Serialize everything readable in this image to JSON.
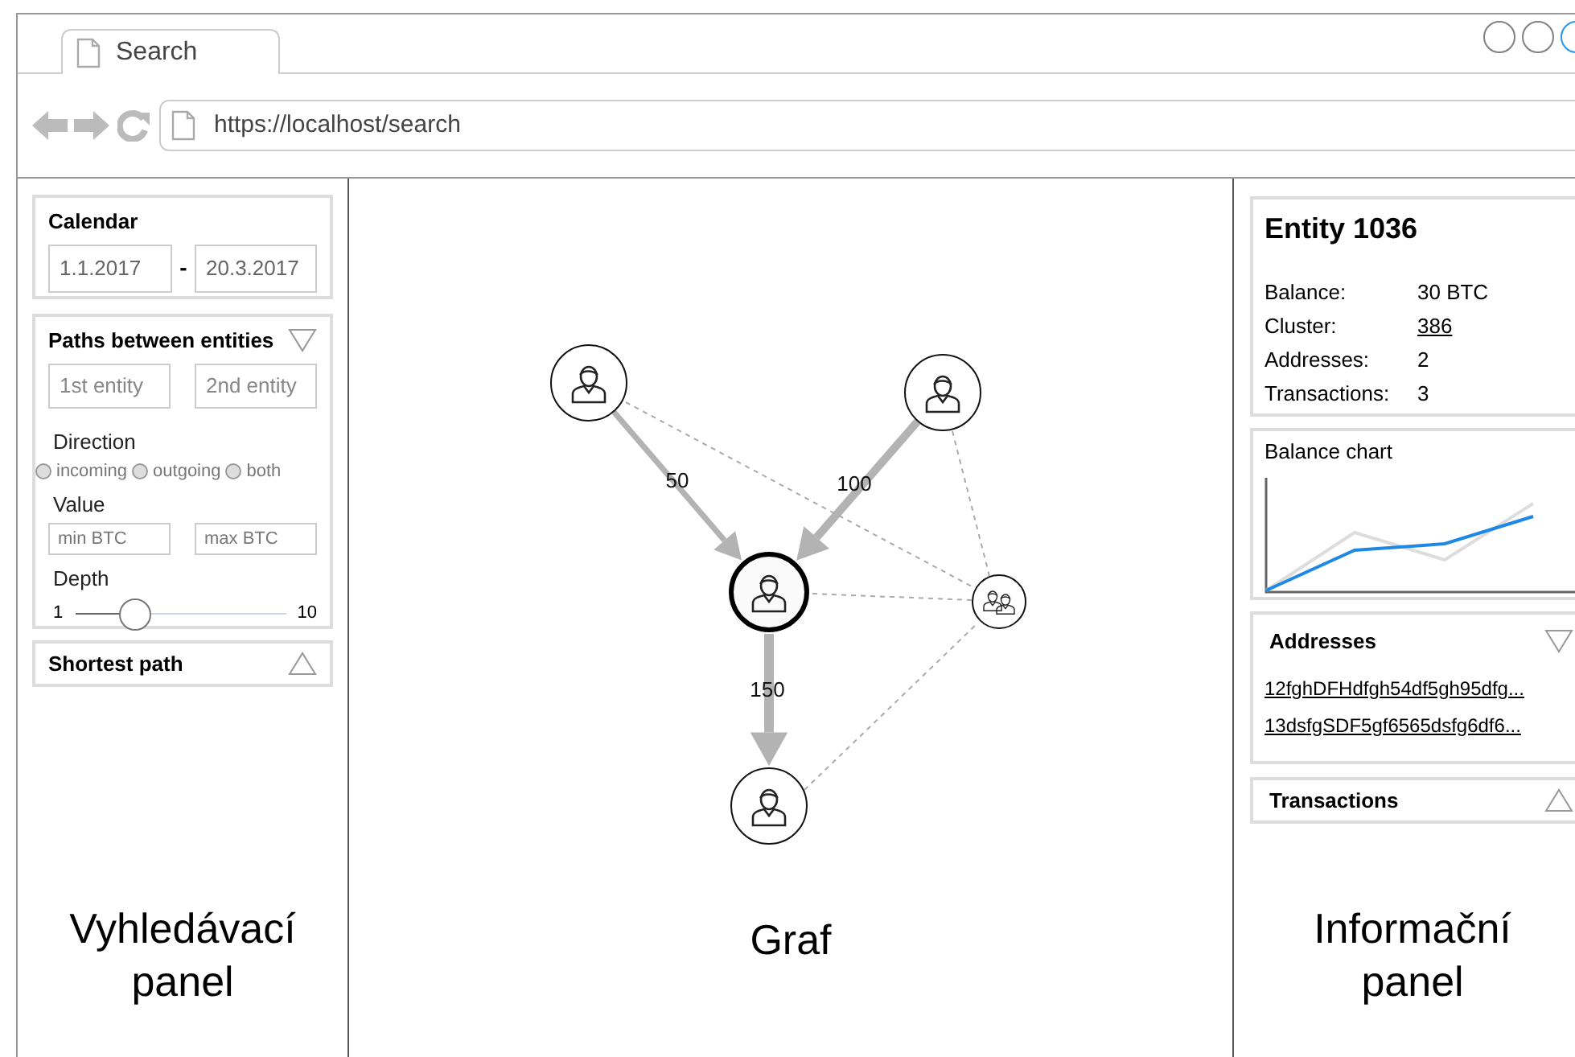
{
  "window": {
    "controls": [
      {
        "color": "#808080"
      },
      {
        "color": "#808080"
      },
      {
        "color": "#2196f3"
      }
    ]
  },
  "tab": {
    "title": "Search"
  },
  "address_bar": {
    "url": "https://localhost/search"
  },
  "search_panel": {
    "calendar": {
      "title": "Calendar",
      "from": "1.1.2017",
      "separator": "-",
      "to": "20.3.2017"
    },
    "paths": {
      "title": "Paths between entities",
      "expanded": true,
      "entity_fields": [
        {
          "placeholder": "1st entity"
        },
        {
          "placeholder": "2nd entity"
        }
      ],
      "direction_label": "Direction",
      "directions": [
        {
          "label": "incoming",
          "selected": false
        },
        {
          "label": "outgoing",
          "selected": false
        },
        {
          "label": "both",
          "selected": false
        }
      ],
      "value_label": "Value",
      "value_fields": [
        {
          "placeholder": "min BTC"
        },
        {
          "placeholder": "max BTC"
        }
      ],
      "depth_label": "Depth",
      "depth_min": "1",
      "depth_max": "10",
      "depth": {
        "level": 0.28
      }
    },
    "shortest_path": {
      "title": "Shortest path",
      "expanded": false
    },
    "caption": "Vyhledávací panel"
  },
  "graph": {
    "nodes": [
      {
        "kind": "person",
        "selected": false
      },
      {
        "kind": "person",
        "selected": false
      },
      {
        "kind": "person",
        "selected": true
      },
      {
        "kind": "group",
        "selected": false
      },
      {
        "kind": "person",
        "selected": false
      }
    ],
    "edges": [
      {
        "kind": "flow",
        "label": "50"
      },
      {
        "kind": "flow",
        "label": "100"
      },
      {
        "kind": "flow",
        "label": "150"
      },
      {
        "kind": "link"
      },
      {
        "kind": "link"
      },
      {
        "kind": "link"
      },
      {
        "kind": "link"
      }
    ],
    "caption": "Graf"
  },
  "info_panel": {
    "entity": {
      "title": "Entity 1036",
      "rows": [
        {
          "label": "Balance:",
          "value": "30 BTC",
          "kind": "text"
        },
        {
          "label": "Cluster:",
          "value": "386",
          "kind": "link"
        },
        {
          "label": "Addresses:",
          "value": "2",
          "kind": "text"
        },
        {
          "label": "Transactions:",
          "value": "3",
          "kind": "text"
        }
      ]
    },
    "balance_chart": {
      "title": "Balance chart"
    },
    "addresses": {
      "title": "Addresses",
      "expanded": true,
      "items": [
        "12fghDFHdfgh54df5gh95dfg...",
        "13dsfgSDF5gf6565dsfg6df6..."
      ]
    },
    "transactions": {
      "title": "Transactions",
      "expanded": false
    },
    "caption": "Informační panel"
  }
}
